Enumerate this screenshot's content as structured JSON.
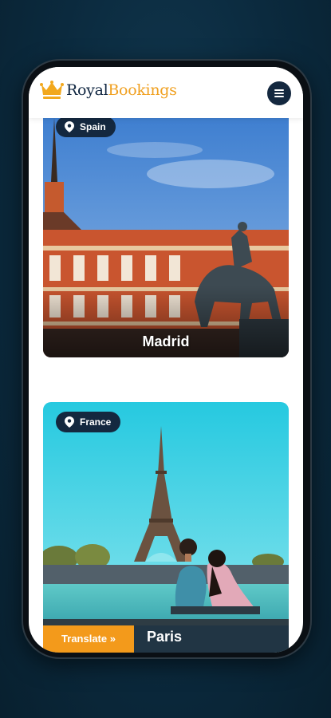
{
  "header": {
    "brand_primary": "Royal",
    "brand_secondary": "Bookings",
    "logo_icon": "crown-icon",
    "menu_icon": "hamburger-icon"
  },
  "destinations": [
    {
      "country": "Spain",
      "city": "Madrid",
      "icon": "map-pin-icon"
    },
    {
      "country": "France",
      "city": "Paris",
      "icon": "map-pin-icon"
    }
  ],
  "footer": {
    "translate_label": "Translate »"
  },
  "colors": {
    "navy": "#14283f",
    "accent_orange": "#f39a1b",
    "brand_gold": "#f0a020"
  }
}
